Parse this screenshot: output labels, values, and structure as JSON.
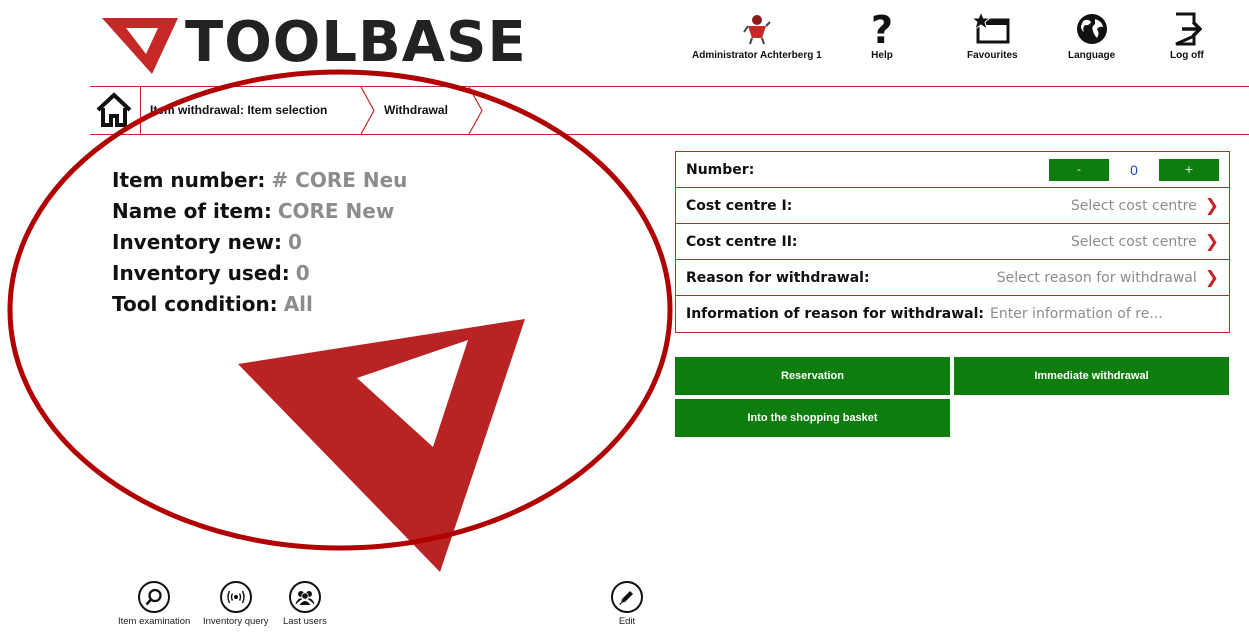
{
  "header": {
    "logo_text": "TOOLBASE",
    "user": "Administrator Achterberg 1",
    "help": "Help",
    "favourites": "Favourites",
    "language": "Language",
    "logoff": "Log off"
  },
  "breadcrumb": {
    "items": [
      "Item withdrawal: Item selection",
      "Withdrawal"
    ]
  },
  "item": {
    "number_label": "Item number:",
    "number_value": "# CORE Neu",
    "name_label": "Name of item:",
    "name_value": "CORE New",
    "inv_new_label": "Inventory new:",
    "inv_new_value": "0",
    "inv_used_label": "Inventory used:",
    "inv_used_value": "0",
    "condition_label": "Tool condition:",
    "condition_value": "All"
  },
  "form": {
    "number_label": "Number:",
    "minus": "-",
    "number_value": "0",
    "plus": "+",
    "cost1_label": "Cost centre I:",
    "cost1_value": "Select cost centre",
    "cost2_label": "Cost centre II:",
    "cost2_value": "Select cost centre",
    "reason_label": "Reason for withdrawal:",
    "reason_value": "Select reason for withdrawal",
    "info_label": "Information of reason for withdrawal:",
    "info_placeholder": "Enter information of re..."
  },
  "actions": {
    "reservation": "Reservation",
    "immediate": "Immediate withdrawal",
    "basket": "Into the shopping basket"
  },
  "toolbar": {
    "examination": "Item examination",
    "inventory": "Inventory query",
    "last_users": "Last users",
    "edit": "Edit"
  },
  "colors": {
    "accent_red": "#c62828",
    "button_green": "#0d7d0d",
    "value_grey": "#8c8c8c",
    "stepper_value_blue": "#1f3fcc"
  },
  "icons": [
    "home-icon",
    "user-avatar-icon",
    "help-icon",
    "favourites-icon",
    "language-globe-icon",
    "logoff-icon",
    "magnifier-icon",
    "broadcast-icon",
    "users-icon",
    "pencil-icon",
    "chevron-right-icon"
  ]
}
